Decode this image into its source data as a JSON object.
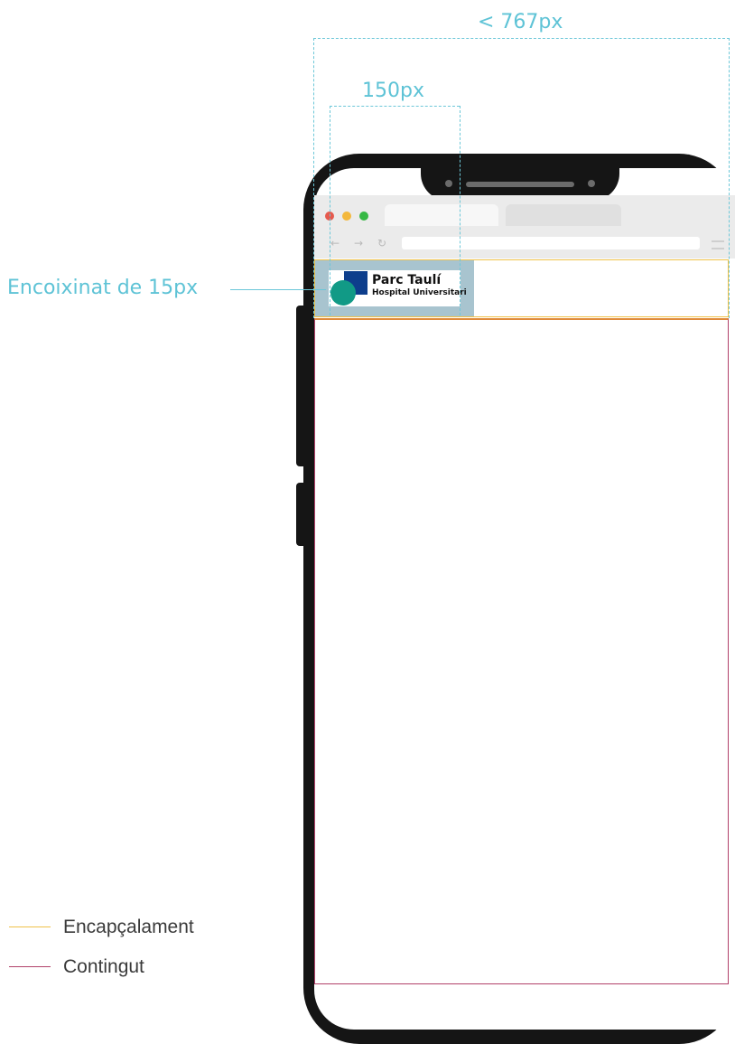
{
  "annotations": {
    "max_width_label": "< 767px",
    "logo_width_label": "150px",
    "padding_label": "Encoixinat de 15px"
  },
  "logo": {
    "title": "Parc Taulí",
    "subtitle": "Hospital Universitari"
  },
  "legend": [
    {
      "label": "Encapçalament",
      "color": "#f0c24a"
    },
    {
      "label": "Contingut",
      "color": "#b1416a"
    }
  ],
  "colors": {
    "annotation": "#5ec3d6",
    "header_outline": "#f0c24a",
    "content_outline": "#b1416a",
    "logo_padding_fill": "#a8c4cf"
  }
}
